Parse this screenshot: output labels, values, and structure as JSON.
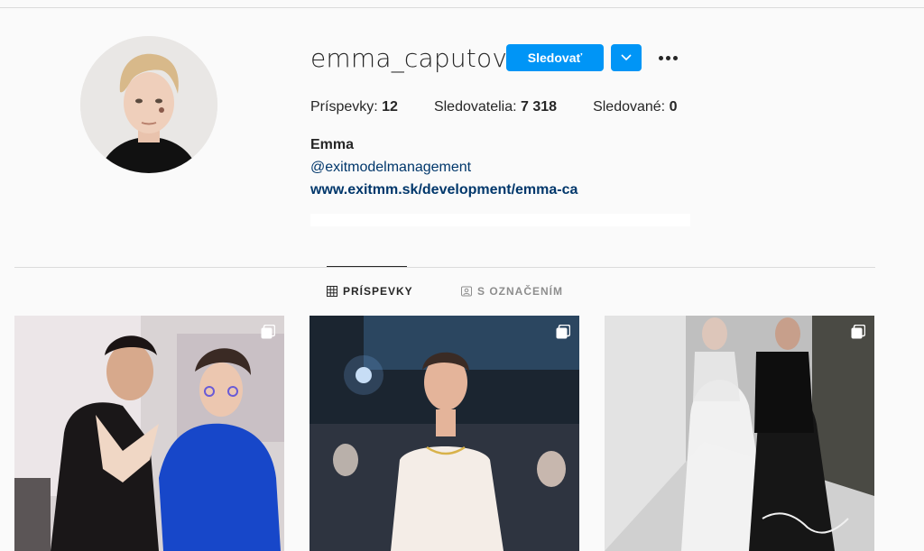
{
  "profile": {
    "username": "emma_caputova",
    "follow_label": "Sledovať",
    "stats": {
      "posts_label": "Príspevky:",
      "posts_value": "12",
      "followers_label": "Sledovatelia:",
      "followers_value": "7 318",
      "following_label": "Sledované:",
      "following_value": "0"
    },
    "full_name": "Emma",
    "mention": "@exitmodelmanagement",
    "website": "www.exitmm.sk/development/emma-ca"
  },
  "tabs": [
    {
      "label": "PRÍSPEVKY",
      "icon": "grid-icon",
      "active": true
    },
    {
      "label": "S OZNAČENÍM",
      "icon": "tagged-icon",
      "active": false
    }
  ],
  "colors": {
    "accent": "#0095f6",
    "link": "#00376b",
    "text": "#262626",
    "muted": "#8e8e8e",
    "background": "#fafafa",
    "divider": "#dbdbdb"
  }
}
